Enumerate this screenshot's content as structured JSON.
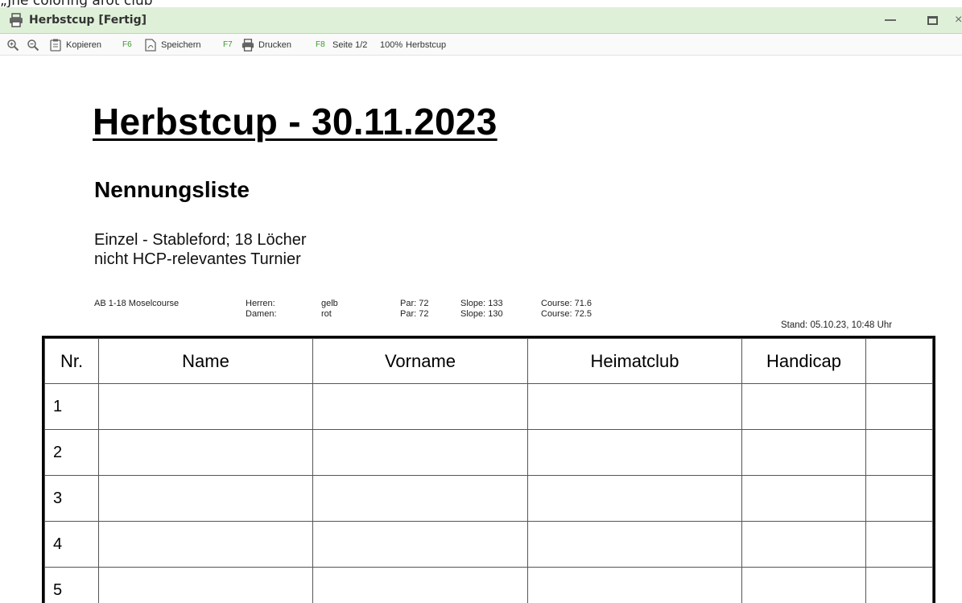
{
  "window": {
    "cut_text": "„Jhe coloring arot club",
    "title": "Herbstcup [Fertig]",
    "close_glyph": "×"
  },
  "toolbar": {
    "copy_label": "Kopieren",
    "copy_key": "F6",
    "save_label": "Speichern",
    "save_key": "F7",
    "print_label": "Drucken",
    "print_key": "F8",
    "page_info": "Seite 1/2",
    "zoom": "100%",
    "doc_name": "Herbstcup"
  },
  "document": {
    "title": "Herbstcup - 30.11.2023",
    "subtitle": "Nennungsliste",
    "desc_line1": "Einzel - Stableford; 18 Löcher",
    "desc_line2": "nicht HCP-relevantes Turnier",
    "course": "AB 1-18 Moselcourse",
    "tees": [
      {
        "label": "Herren:",
        "color": "gelb",
        "par": "Par: 72",
        "slope": "Slope: 133",
        "course": "Course: 71.6"
      },
      {
        "label": "Damen:",
        "color": "rot",
        "par": "Par: 72",
        "slope": "Slope: 130",
        "course": "Course: 72.5"
      }
    ],
    "stand": "Stand: 05.10.23, 10:48 Uhr"
  },
  "table": {
    "headers": [
      "Nr.",
      "Name",
      "Vorname",
      "Heimatclub",
      "Handicap",
      ""
    ],
    "rows": [
      "1",
      "2",
      "3",
      "4",
      "5"
    ]
  },
  "colors": {
    "titlebar_bg": "#dff0d8",
    "fkey_green": "#3a9a2a"
  }
}
